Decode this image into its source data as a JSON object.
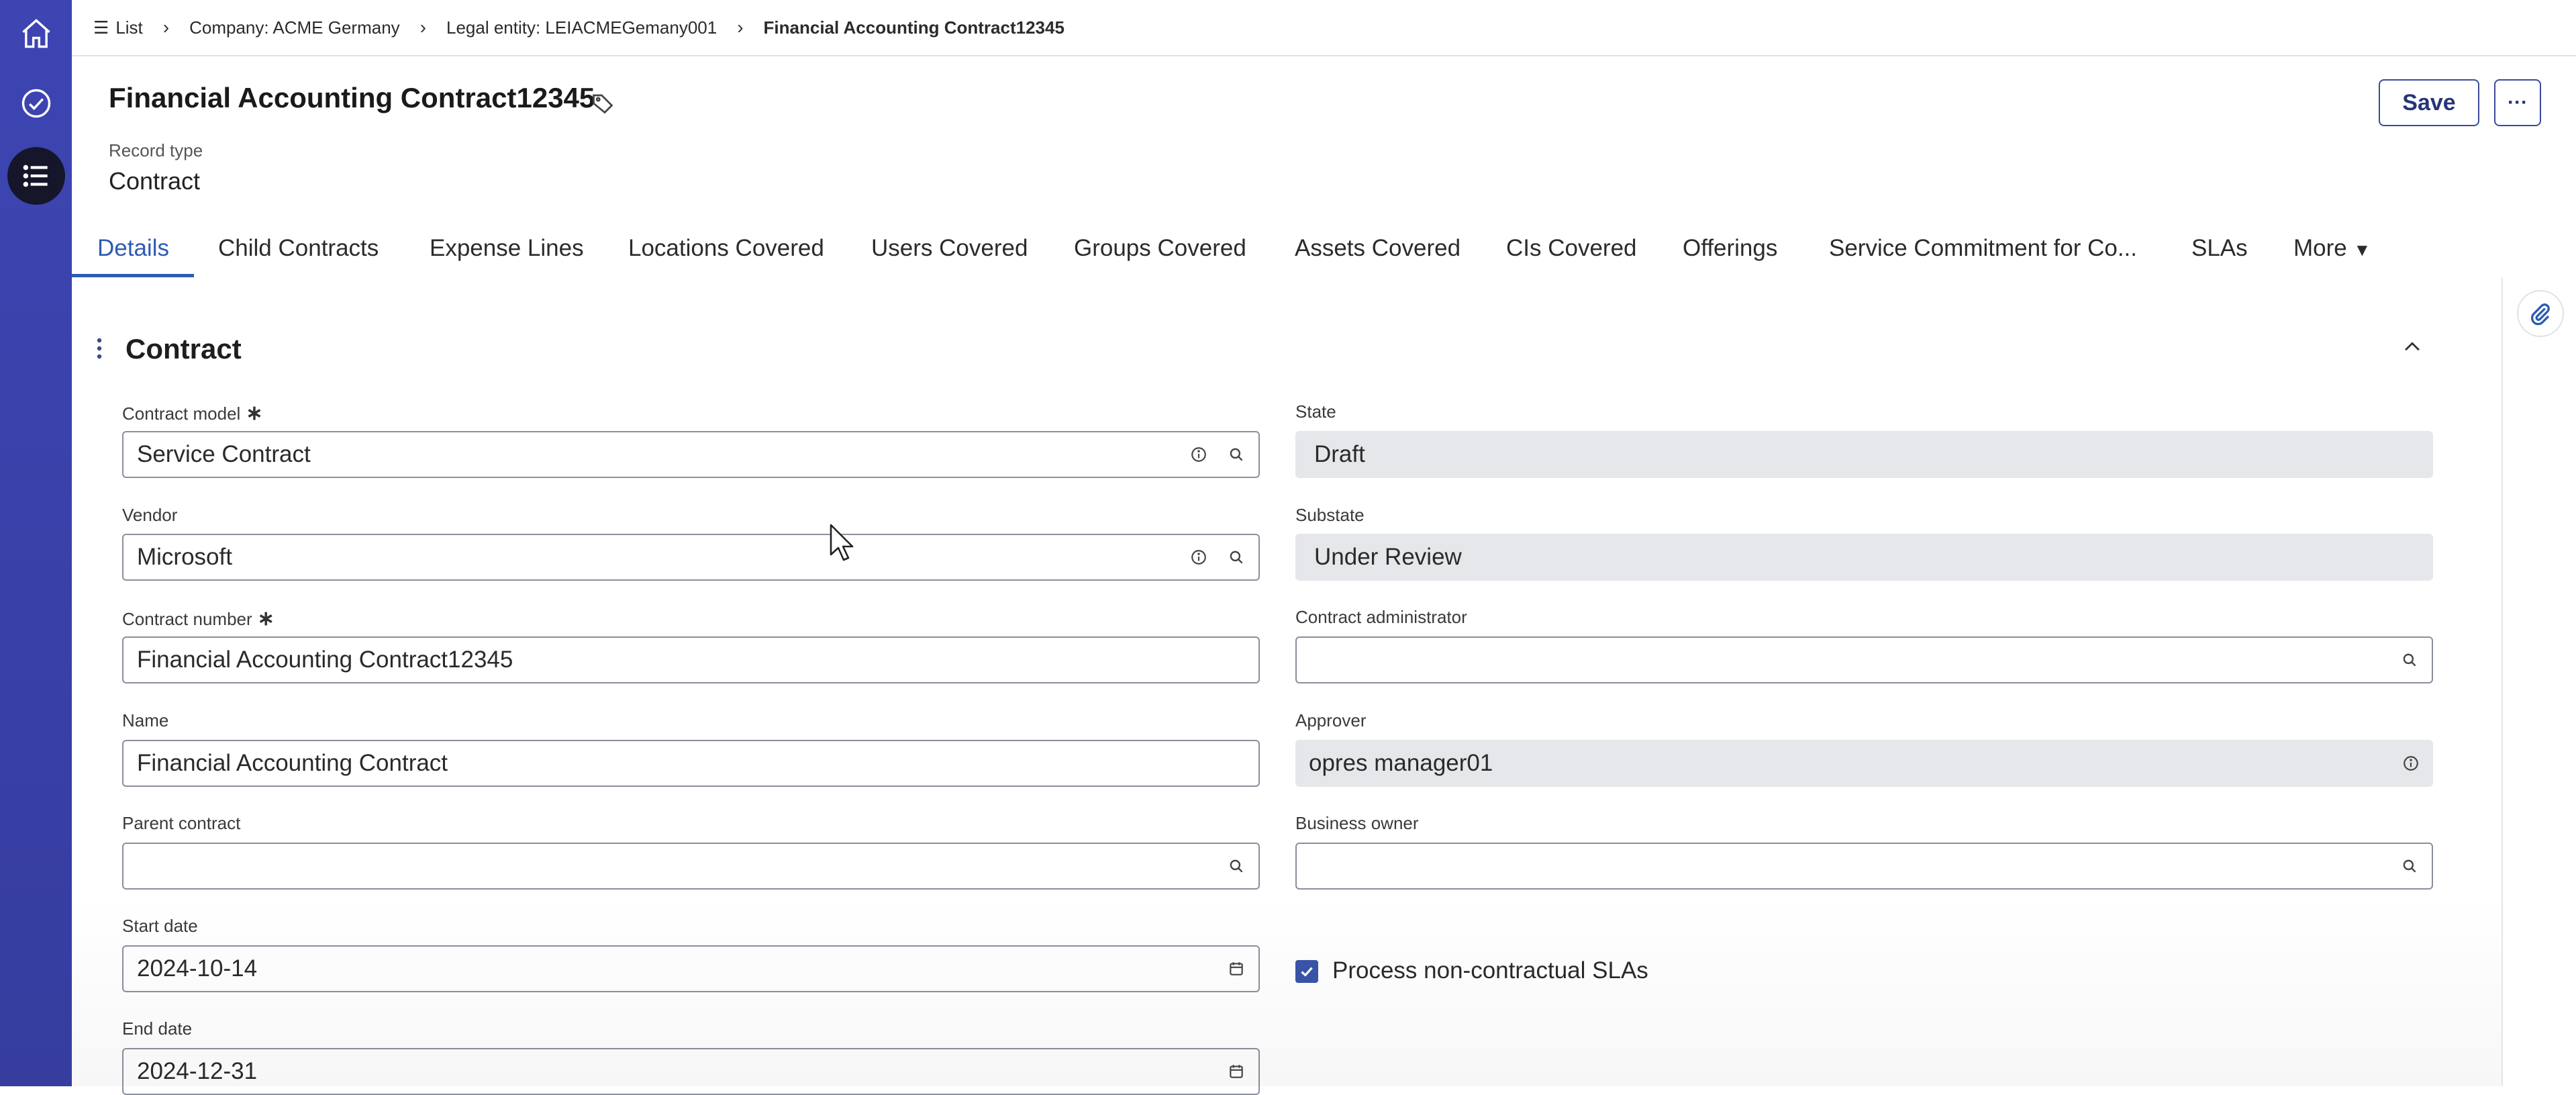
{
  "rail": {
    "items": [
      "home-icon",
      "approvals-icon",
      "list-menu-icon"
    ]
  },
  "breadcrumb": {
    "list_label": "List",
    "company": "Company: ACME Germany",
    "legal_entity": "Legal entity: LEIACMEGemany001",
    "current": "Financial Accounting Contract12345"
  },
  "header": {
    "title": "Financial Accounting Contract12345",
    "record_type_label": "Record type",
    "record_type_value": "Contract",
    "save_label": "Save",
    "more_label": "···"
  },
  "tabs": [
    "Details",
    "Child Contracts",
    "Expense Lines",
    "Locations Covered",
    "Users Covered",
    "Groups Covered",
    "Assets Covered",
    "CIs Covered",
    "Offerings",
    "Service Commitment for Co...",
    "SLAs",
    "More"
  ],
  "section": {
    "title": "Contract"
  },
  "fields": {
    "contract_model": {
      "label": "Contract model",
      "value": "Service Contract"
    },
    "vendor": {
      "label": "Vendor",
      "value": "Microsoft"
    },
    "contract_number": {
      "label": "Contract number",
      "value": "Financial Accounting Contract12345"
    },
    "name": {
      "label": "Name",
      "value": "Financial Accounting Contract"
    },
    "parent_contract": {
      "label": "Parent contract",
      "value": ""
    },
    "start_date": {
      "label": "Start date",
      "value": "2024-10-14"
    },
    "end_date": {
      "label": "End date",
      "value": "2024-12-31"
    },
    "state": {
      "label": "State",
      "value": "Draft"
    },
    "substate": {
      "label": "Substate",
      "value": "Under Review"
    },
    "contract_administrator": {
      "label": "Contract administrator",
      "value": ""
    },
    "approver": {
      "label": "Approver",
      "value": "opres manager01"
    },
    "business_owner": {
      "label": "Business owner",
      "value": ""
    },
    "process_non_contractual_slas": {
      "label": "Process non-contractual SLAs",
      "checked": true
    }
  },
  "colors": {
    "rail": "#3a3fa8",
    "accent": "#2d5bb3",
    "readonly_bg": "#e6e7ea"
  }
}
